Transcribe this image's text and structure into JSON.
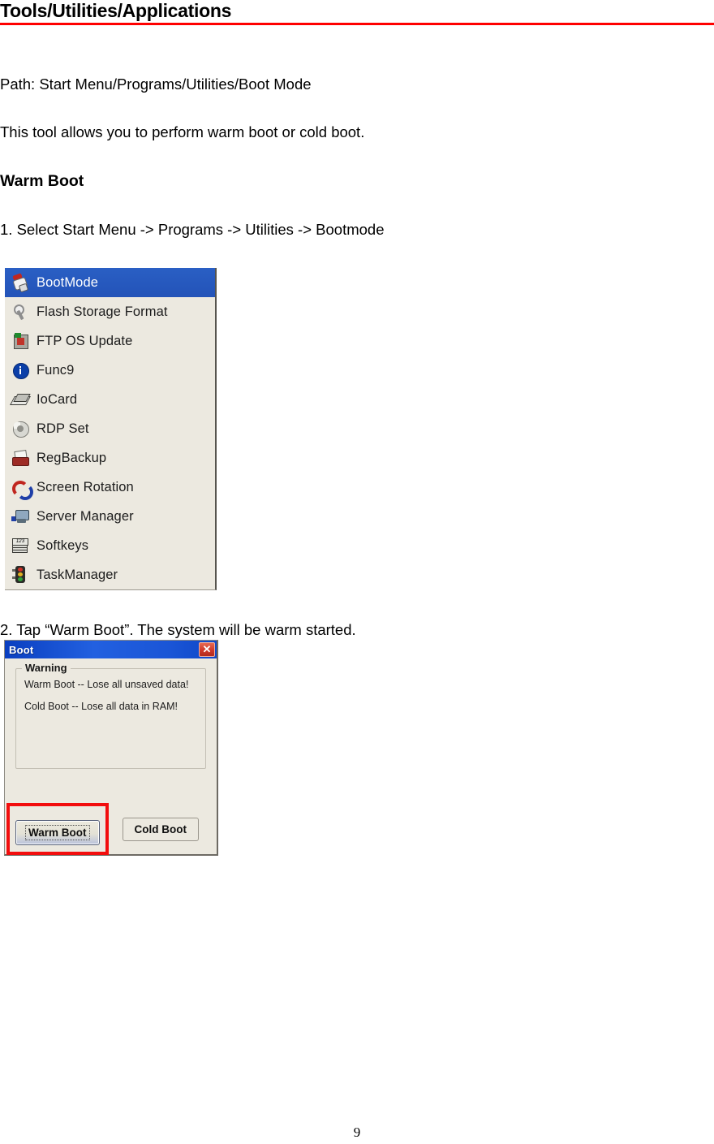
{
  "header": {
    "title": "Tools/Utilities/Applications",
    "rule_color": "#ff0000"
  },
  "content": {
    "path_line": "Path: Start Menu/Programs/Utilities/Boot Mode",
    "intro_line": "This tool allows you to perform warm boot or cold boot.",
    "section_heading": "Warm Boot",
    "step1": "1. Select Start Menu -> Programs -> Utilities -> Bootmode",
    "step2": "2. Tap “Warm Boot”. The system will be warm started."
  },
  "programs_menu": {
    "selected_index": 0,
    "selected_bg": "#2353b8",
    "background": "#ece9e0",
    "items": [
      {
        "label": "BootMode",
        "icon": "bootmode-icon"
      },
      {
        "label": "Flash Storage Format",
        "icon": "wrench-icon"
      },
      {
        "label": "FTP OS Update",
        "icon": "chip-icon"
      },
      {
        "label": "Func9",
        "icon": "info-icon"
      },
      {
        "label": "IoCard",
        "icon": "card-icon"
      },
      {
        "label": "RDP Set",
        "icon": "disc-icon"
      },
      {
        "label": "RegBackup",
        "icon": "printer-icon"
      },
      {
        "label": "Screen Rotation",
        "icon": "rotate-icon"
      },
      {
        "label": "Server Manager",
        "icon": "monitor-icon"
      },
      {
        "label": "Softkeys",
        "icon": "keyboard-icon"
      },
      {
        "label": "TaskManager",
        "icon": "traffic-light-icon"
      }
    ]
  },
  "boot_dialog": {
    "title": "Boot",
    "close_label": "✕",
    "titlebar_color": "#1a55d6",
    "warning": {
      "legend": "Warning",
      "line1": "Warm Boot -- Lose all unsaved data!",
      "line2": "Cold Boot -- Lose all data in RAM!"
    },
    "buttons": {
      "warm_boot": "Warm Boot",
      "cold_boot": "Cold Boot",
      "highlight_color": "#f20d0d"
    }
  },
  "footer": {
    "page_number": "9"
  },
  "softkeys_icon_digits": "123"
}
